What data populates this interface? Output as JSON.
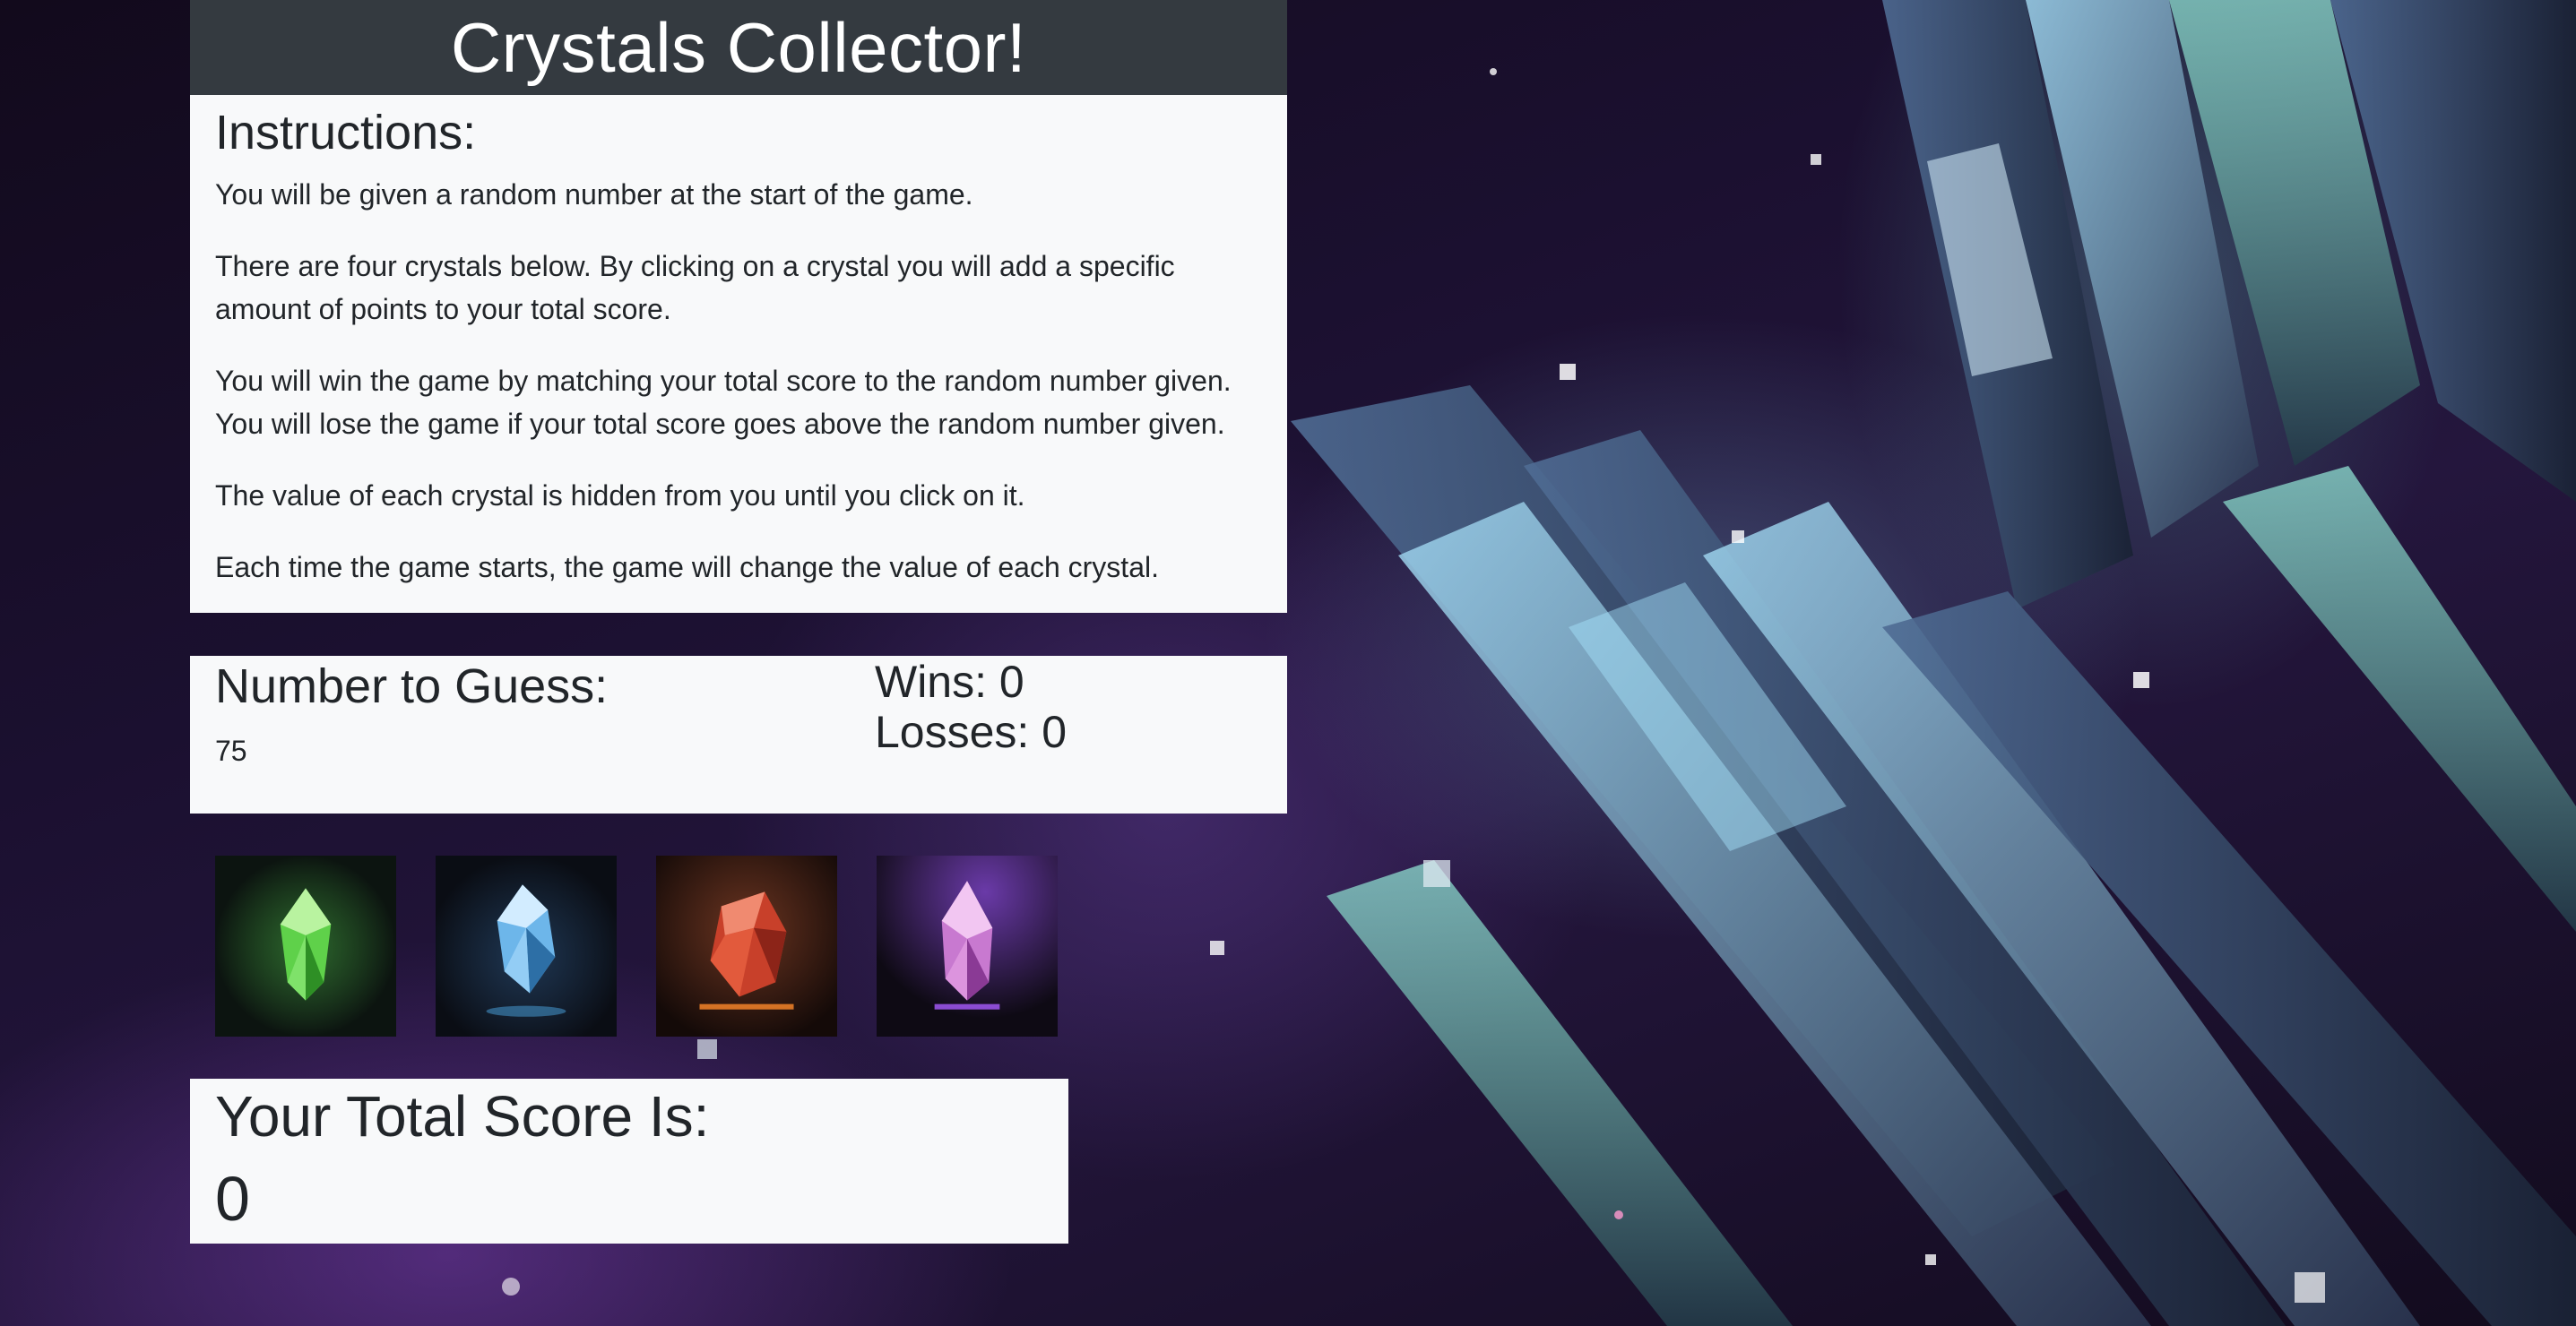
{
  "header": {
    "title": "Crystals Collector!"
  },
  "instructions": {
    "heading": "Instructions:",
    "paragraphs": [
      "You will be given a random number at the start of the game.",
      "There are four crystals below. By clicking on a crystal you will add a specific amount of points to your total score.",
      "You will win the game by matching your total score to the random number given. You will lose the game if your total score goes above the random number given.",
      "The value of each crystal is hidden from you until you click on it.",
      "Each time the game starts, the game will change the value of each crystal."
    ]
  },
  "stats": {
    "guess_label": "Number to Guess:",
    "guess_value": "75",
    "wins_text": "Wins: 0",
    "losses_text": "Losses: 0"
  },
  "crystals": [
    {
      "icon": "green-crystal-icon",
      "color": "#4fc23a"
    },
    {
      "icon": "blue-crystal-icon",
      "color": "#5aa8e6"
    },
    {
      "icon": "red-crystal-icon",
      "color": "#d2402a"
    },
    {
      "icon": "purple-crystal-icon",
      "color": "#c77bd6"
    }
  ],
  "score": {
    "label": "Your Total Score Is:",
    "value": "0"
  }
}
